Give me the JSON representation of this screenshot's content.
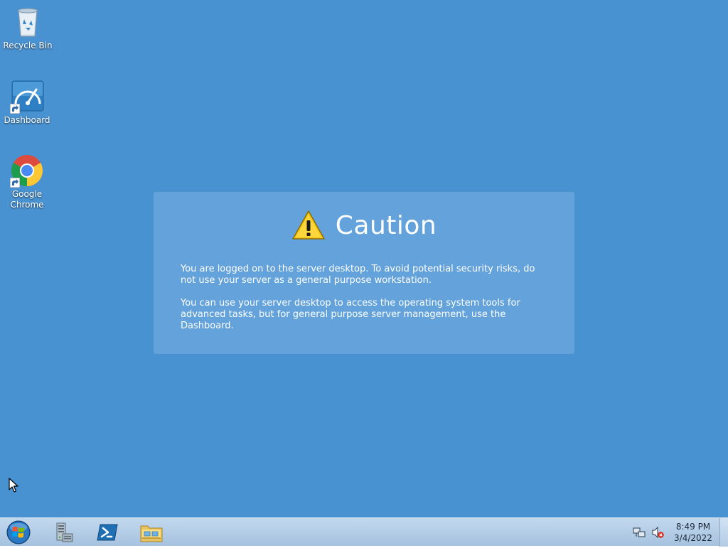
{
  "desktop": {
    "background_color": "#4992d2",
    "icons": [
      {
        "label": "Recycle Bin",
        "icon": "recycle-bin-icon"
      },
      {
        "label": "Dashboard",
        "icon": "dashboard-icon"
      },
      {
        "label": "Google Chrome",
        "icon": "chrome-icon"
      }
    ]
  },
  "caution": {
    "title": "Caution",
    "icon": "warning-icon",
    "paragraphs": [
      "You are logged on to the server desktop. To avoid potential security risks, do not use your server as a general purpose workstation.",
      "You can use your server desktop to access the operating system tools for advanced tasks, but for general purpose server management, use the Dashboard."
    ]
  },
  "taskbar": {
    "pinned": [
      {
        "icon": "server-manager-icon"
      },
      {
        "icon": "powershell-icon"
      },
      {
        "icon": "file-explorer-icon"
      }
    ],
    "tray_icons": [
      "network-icon",
      "volume-muted-icon"
    ],
    "clock": {
      "time": "8:49 PM",
      "date": "3/4/2022"
    }
  }
}
